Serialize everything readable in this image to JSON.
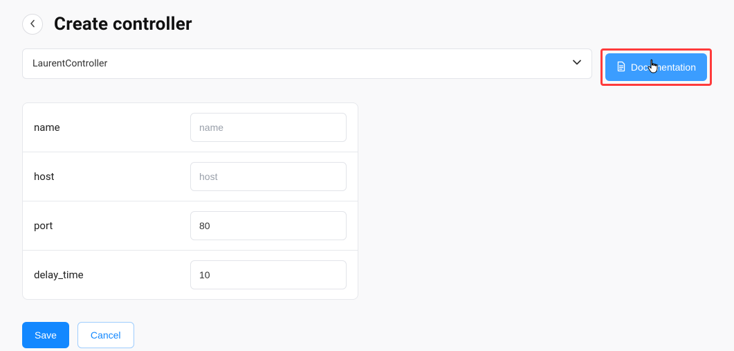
{
  "header": {
    "title": "Create controller"
  },
  "controller_select": {
    "value": "LaurentController"
  },
  "documentation_button": {
    "label": "Documentation"
  },
  "form": {
    "fields": [
      {
        "label": "name",
        "placeholder": "name",
        "value": ""
      },
      {
        "label": "host",
        "placeholder": "host",
        "value": ""
      },
      {
        "label": "port",
        "placeholder": "",
        "value": "80"
      },
      {
        "label": "delay_time",
        "placeholder": "",
        "value": "10"
      }
    ]
  },
  "actions": {
    "save_label": "Save",
    "cancel_label": "Cancel"
  }
}
